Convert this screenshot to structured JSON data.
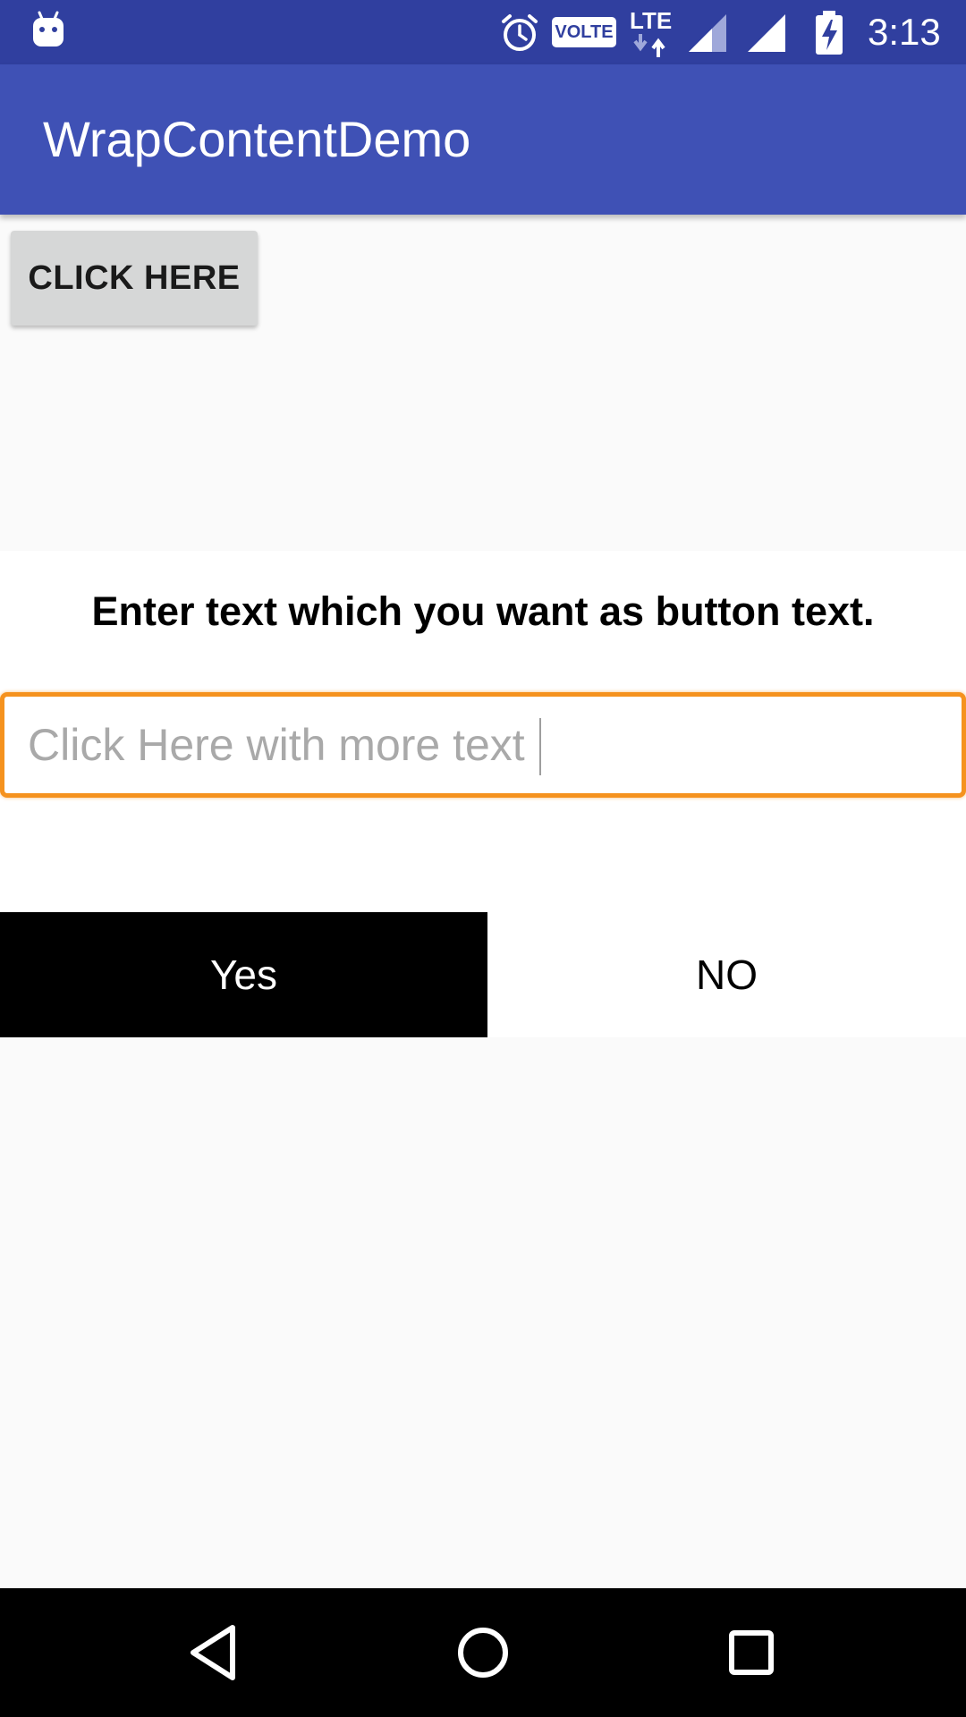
{
  "status_bar": {
    "time": "3:13",
    "volte_label": "VOLTE",
    "icons": [
      "android-debug-icon",
      "alarm-icon",
      "volte-icon",
      "lte-data-icon",
      "signal-icon",
      "signal-icon",
      "battery-charging-icon"
    ]
  },
  "app_bar": {
    "title": "WrapContentDemo"
  },
  "main": {
    "click_button_label": "CLICK HERE",
    "prompt": "Enter text which you want as button text.",
    "text_field": {
      "value": "",
      "placeholder": "Click Here with more text"
    },
    "yes_label": "Yes",
    "no_label": "NO"
  },
  "nav_bar": {
    "icons": [
      "back-icon",
      "home-icon",
      "recents-icon"
    ]
  },
  "colors": {
    "status_bar": "#303f9f",
    "app_bar": "#3f51b5",
    "focus_border": "#f5921e",
    "yes_button": "#000000"
  }
}
